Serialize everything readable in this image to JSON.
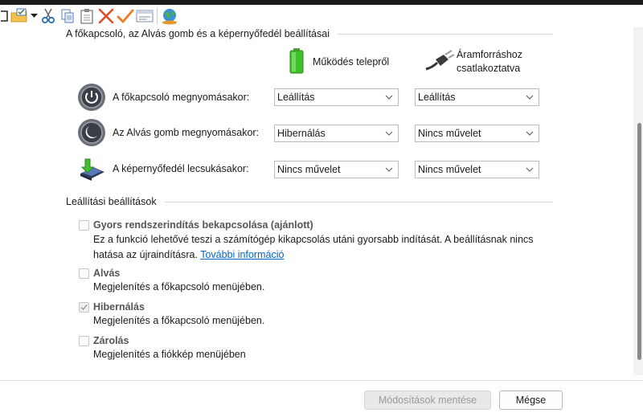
{
  "toolbar": {
    "icons": [
      "window-icon",
      "folder-checklist-icon",
      "dropdown-arrow-icon",
      "cut-icon",
      "copy-icon",
      "paste-icon",
      "delete-icon",
      "checkmark-icon",
      "card-icon",
      "globe-icon"
    ]
  },
  "power_group": {
    "title": "A főkapcsoló, az Alvás gomb és a képernyőfedél beállításai",
    "col_battery": "Működés telepről",
    "col_plugged_line1": "Áramforráshoz",
    "col_plugged_line2": "csatlakoztatva",
    "rows": [
      {
        "label": "A főkapcsoló megnyomásakor:",
        "battery": "Leállítás",
        "plugged": "Leállítás"
      },
      {
        "label": "Az Alvás gomb megnyomásakor:",
        "battery": "Hibernálás",
        "plugged": "Nincs művelet"
      },
      {
        "label": "A képernyőfedél lecsukásakor:",
        "battery": "Nincs művelet",
        "plugged": "Nincs művelet"
      }
    ]
  },
  "shutdown_group": {
    "title": "Leállítási beállítások",
    "fast_startup": {
      "label": "Gyors rendszerindítás bekapcsolása (ajánlott)",
      "checked": false,
      "desc_line1": "Ez a funkció lehetővé teszi a számítógép kikapcsolás utáni gyorsabb indítását. A beállításnak nincs",
      "desc_line2": "hatása az újraindításra.",
      "link": "További információ"
    },
    "sleep": {
      "label": "Alvás",
      "checked": false,
      "desc": "Megjelenítés a főkapcsoló menüjében."
    },
    "hibernate": {
      "label": "Hibernálás",
      "checked": true,
      "desc": "Megjelenítés a főkapcsoló menüjében."
    },
    "lock": {
      "label": "Zárolás",
      "checked": false,
      "desc": "Megjelenítés a fiókkép menüjében"
    }
  },
  "footer": {
    "save_label": "Módosítások mentése",
    "cancel_label": "Mégse"
  }
}
